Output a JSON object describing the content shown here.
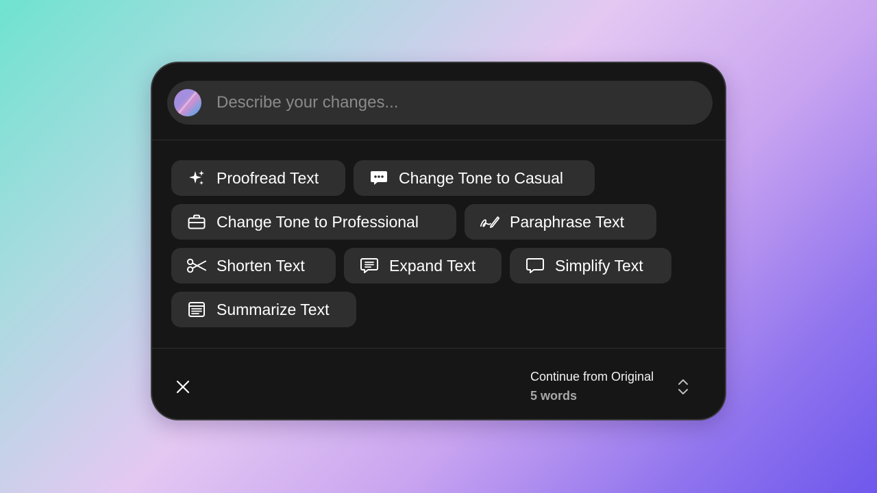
{
  "prompt": {
    "placeholder": "Describe your changes..."
  },
  "actions": [
    {
      "label": "Proofread Text",
      "icon": "sparkles-icon"
    },
    {
      "label": "Change Tone to Casual",
      "icon": "chat-bubble-icon"
    },
    {
      "label": "Change Tone to Professional",
      "icon": "briefcase-icon"
    },
    {
      "label": "Paraphrase Text",
      "icon": "signature-pen-icon"
    },
    {
      "label": "Shorten Text",
      "icon": "scissors-icon"
    },
    {
      "label": "Expand Text",
      "icon": "text-bubble-icon"
    },
    {
      "label": "Simplify Text",
      "icon": "speech-bubble-icon"
    },
    {
      "label": "Summarize Text",
      "icon": "document-lines-icon"
    }
  ],
  "footer": {
    "continue_label": "Continue from Original",
    "word_count": "5 words"
  },
  "colors": {
    "panel": "#161616",
    "chip": "#2f2f2f",
    "text": "#ffffff"
  }
}
